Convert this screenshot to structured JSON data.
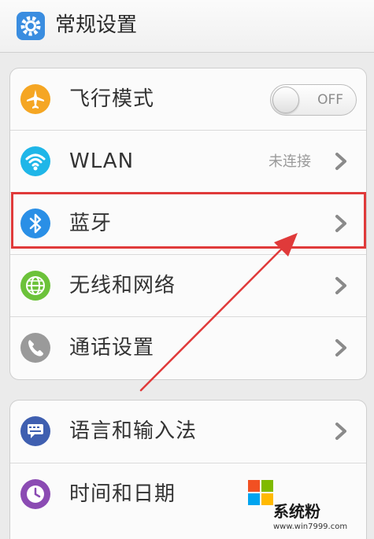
{
  "header": {
    "title": "常规设置",
    "icon": "gear-icon",
    "icon_color": "#3a8de0"
  },
  "groups": [
    {
      "items": [
        {
          "label": "飞行模式",
          "icon": "airplane-icon",
          "icon_color": "#f5a623",
          "control": "toggle",
          "toggle_text": "OFF",
          "toggle_on": false
        },
        {
          "label": "WLAN",
          "icon": "wifi-icon",
          "icon_color": "#1fb6e8",
          "status": "未连接",
          "control": "chevron"
        },
        {
          "label": "蓝牙",
          "icon": "bluetooth-icon",
          "icon_color": "#2a8fe6",
          "control": "chevron",
          "highlighted": true
        },
        {
          "label": "无线和网络",
          "icon": "globe-icon",
          "icon_color": "#6cc23a",
          "control": "chevron"
        },
        {
          "label": "通话设置",
          "icon": "phone-icon",
          "icon_color": "#9a9a9a",
          "control": "chevron"
        }
      ]
    },
    {
      "items": [
        {
          "label": "语言和输入法",
          "icon": "keyboard-icon",
          "icon_color": "#3f5fb0",
          "control": "chevron"
        },
        {
          "label": "时间和日期",
          "icon": "clock-icon",
          "icon_color": "#8b4bb3",
          "control": "chevron"
        }
      ]
    }
  ],
  "annotation": {
    "highlight_color": "#e03a3a"
  },
  "watermark": {
    "name": "系统粉",
    "url": "www.win7999.com",
    "colors": [
      "#f25022",
      "#7fba00",
      "#00a4ef",
      "#ffb900"
    ]
  }
}
